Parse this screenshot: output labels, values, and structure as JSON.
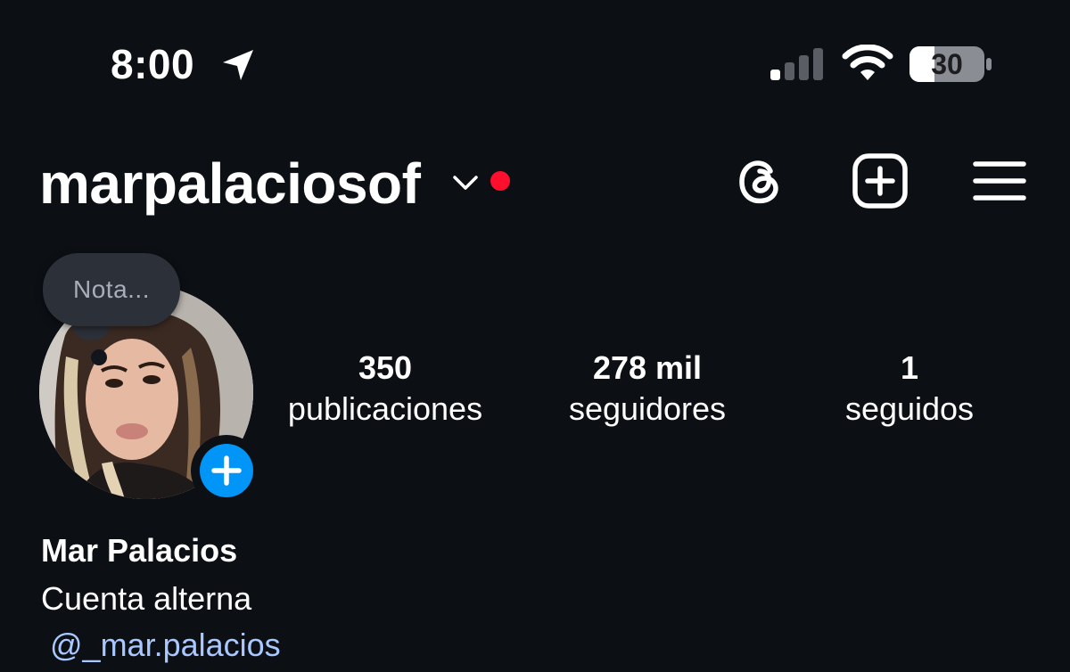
{
  "status_bar": {
    "time": "8:00",
    "battery": "30"
  },
  "header": {
    "username": "marpalaciosof",
    "icons": [
      "threads-icon",
      "add-post-icon",
      "menu-icon"
    ]
  },
  "note": {
    "placeholder": "Nota..."
  },
  "stats": [
    {
      "value": "350",
      "label": "publicaciones"
    },
    {
      "value": "278 mil",
      "label": "seguidores"
    },
    {
      "value": "1",
      "label": "seguidos"
    }
  ],
  "profile": {
    "name": "Mar Palacios",
    "bio": "Cuenta alterna",
    "mention": "@_mar.palacios"
  },
  "colors": {
    "background": "#0c0f14",
    "accent_blue": "#0095f6",
    "notification_red": "#ff0f2e",
    "mention": "#a8c8ff"
  }
}
